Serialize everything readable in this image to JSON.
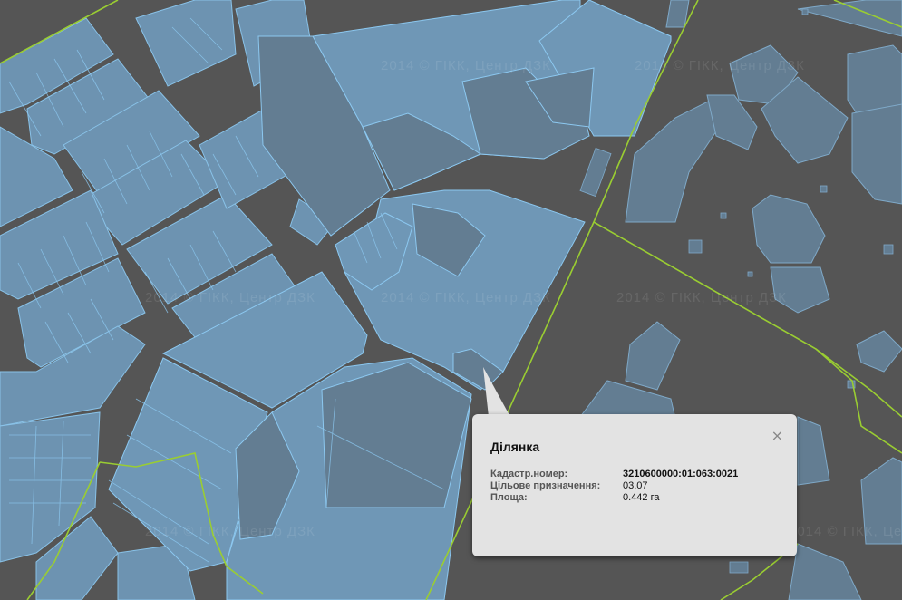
{
  "map": {
    "watermark_text": "2014 © ГІКК, Центр ДЗК",
    "colors": {
      "background": "#555555",
      "road": "#4d4d4d",
      "parcel_fill": "#6f97b6",
      "parcel_stroke": "#8cc8f0",
      "building_fill": "#637d92",
      "boundary_line": "#9acd32"
    }
  },
  "popup": {
    "title": "Ділянка",
    "close_label": "×",
    "rows": [
      {
        "label": "Кадастр.номер:",
        "value": "3210600000:01:063:0021"
      },
      {
        "label": "Цільове призначення:",
        "value": "03.07"
      },
      {
        "label": "Площа:",
        "value": "0.442 га"
      }
    ]
  }
}
